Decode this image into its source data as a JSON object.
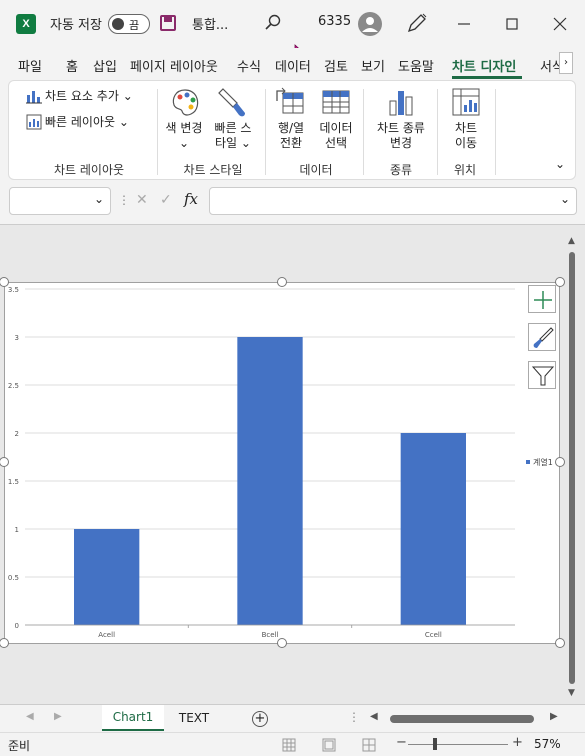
{
  "titlebar": {
    "logo": "X",
    "autosave_label": "자동 저장",
    "toggle_state": "끔",
    "filename": "통합...",
    "number_badge": "6335"
  },
  "ribbon_tabs": [
    "파일",
    "홈",
    "삽입",
    "페이지 레이아웃",
    "수식",
    "데이터",
    "검토",
    "보기",
    "도움말",
    "차트 디자인",
    "서식"
  ],
  "ribbon": {
    "add_element": "차트 요소 추가",
    "quick_layout": "빠른 레이아웃",
    "change_colors_1": "색 변경",
    "quick_styles_1": "빠른 스",
    "quick_styles_2": "타일",
    "switch_rowcol_1": "행/열",
    "switch_rowcol_2": "전환",
    "select_data_1": "데이터",
    "select_data_2": "선택",
    "change_type_1": "차트 종류",
    "change_type_2": "변경",
    "move_chart_1": "차트",
    "move_chart_2": "이동",
    "groups": {
      "layouts": "차트 레이아웃",
      "styles": "차트 스타일",
      "data": "데이터",
      "type": "종류",
      "location": "위치"
    }
  },
  "formula": {
    "fx": "fx",
    "cancel": "✕",
    "enter": "✓"
  },
  "chart_data": {
    "type": "bar",
    "categories": [
      "Acell",
      "Bcell",
      "Ccell"
    ],
    "series": [
      {
        "name": "계열1",
        "values": [
          1,
          3,
          2
        ],
        "color": "#4472c4"
      }
    ],
    "ylim": [
      0,
      3.5
    ],
    "yticks": [
      "0",
      "0.5",
      "1",
      "1.5",
      "2",
      "2.5",
      "3",
      "3.5"
    ],
    "grid": true,
    "legend": "right"
  },
  "sheet_tabs": [
    "Chart1",
    "TEXT"
  ],
  "status": {
    "ready": "준비",
    "zoom": "57%"
  }
}
